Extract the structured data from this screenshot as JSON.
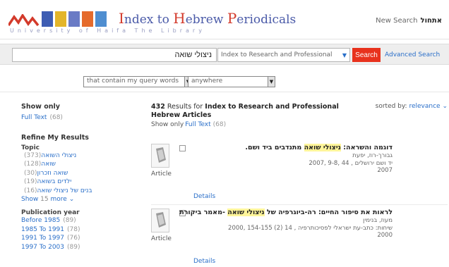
{
  "header": {
    "logo_prefix": "ndex to ",
    "logo_title_parts": [
      "I",
      "ndex to ",
      "H",
      "ebrew ",
      "P",
      "eriodicals"
    ],
    "logo_subtitle": "University of Haifa    The Library",
    "new_search_label": "New Search",
    "new_search_hebrew": "אתחול",
    "brand_colors": {
      "red": "#d33a2b",
      "blue": "#4a5aa8"
    }
  },
  "search": {
    "query": "ניצולי שואה",
    "scope": "Index to Research and Professional",
    "search_button": "Search",
    "advanced_link": "Advanced Search"
  },
  "filters": {
    "match_mode": "that contain my query words",
    "field": "anywhere"
  },
  "sidebar": {
    "show_only_heading": "Show only",
    "full_text_label": "Full Text",
    "full_text_count": "(68)",
    "refine_heading": "Refine My Results",
    "topic_heading": "Topic",
    "topics": [
      {
        "label": "ניצולי השואה",
        "count": "(373)"
      },
      {
        "label": "שואה",
        "count": "(128)"
      },
      {
        "label": "שואה וזכרון",
        "count": "(30)"
      },
      {
        "label": "ילדים בשואה",
        "count": "(19)"
      },
      {
        "label": "בנים של ניצולי שואה",
        "count": "(16)"
      }
    ],
    "show_label": "Show",
    "show_number": "15",
    "more_label": "more",
    "pubyear_heading": "Publication year",
    "years": [
      {
        "label": "Before 1985",
        "count": "(89)"
      },
      {
        "label": "1985 To 1991",
        "count": "(78)"
      },
      {
        "label": "1991 To 1997",
        "count": "(76)"
      },
      {
        "label": "1997 To 2003",
        "count": "(89)"
      }
    ]
  },
  "results": {
    "count": "432",
    "results_for": "Results for",
    "collection": "Index to Research and Professional Hebrew Articles",
    "sorted_by_label": "sorted by:",
    "sorted_by_value": "relevance",
    "show_only_label": "Show only",
    "full_text_label": "Full Text",
    "full_text_count": "(68)",
    "records": [
      {
        "type": "Article",
        "title_pre": "דוגמה והשראה: ",
        "title_highlight": "ניצולי שואה",
        "title_post": " מתנדבים ביד ושם.",
        "author": "גבורך-רוז, יפעת",
        "source": "יד ושם ירושלים , 44 ,9-8 ,2007",
        "year": "2007",
        "details": "Details"
      },
      {
        "type": "Article",
        "title_pre": "לראות את סיפור החיים: רה-ביוגרפיה של ",
        "title_highlight": "ניצולי שואה",
        "title_post": " -מאמר ביקורת",
        "author": "מעוז, בנימין",
        "source": "שיחות: כתב-עת ישראלי לפסיכותרפיה , 14 (2) 154-155 ,2000",
        "year": "2000",
        "details": "Details"
      }
    ]
  }
}
